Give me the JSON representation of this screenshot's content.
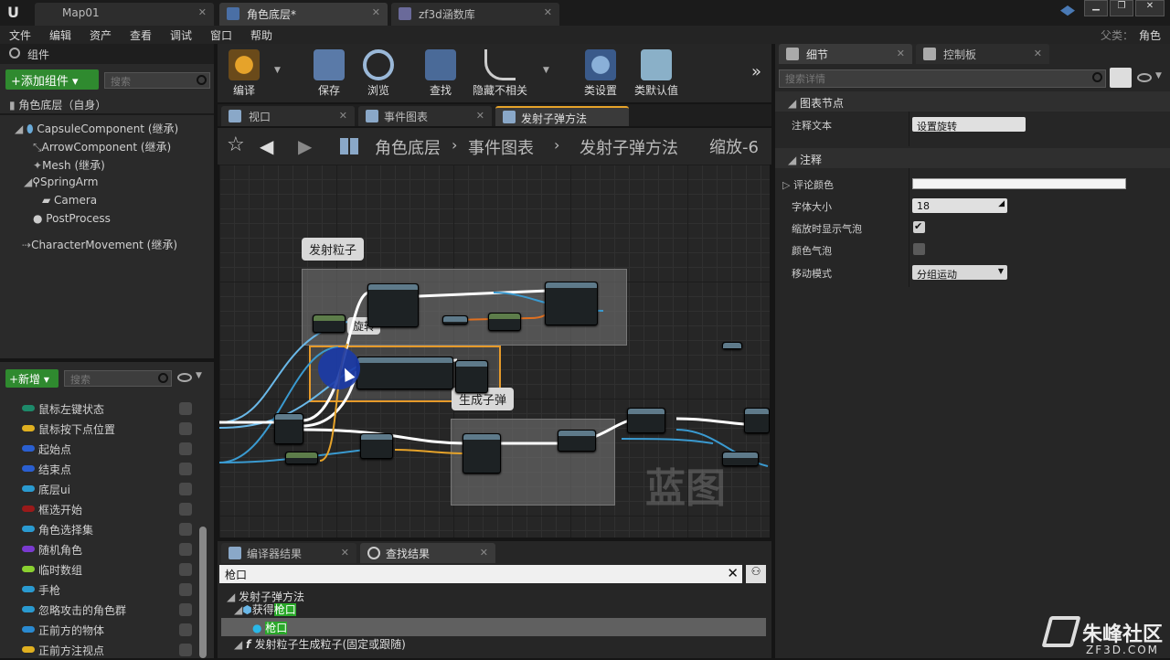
{
  "tabs": [
    {
      "label": "Map01"
    },
    {
      "label": "角色底层*"
    },
    {
      "label": "zf3d涵数库"
    }
  ],
  "menu": [
    "文件",
    "编辑",
    "资产",
    "查看",
    "调试",
    "窗口",
    "帮助"
  ],
  "parent": {
    "label": "父类：",
    "value": "角色"
  },
  "components_panel": {
    "tab": "组件",
    "add_button": "+添加组件 ▾",
    "search_placeholder": "搜索",
    "root": "角色底层（自身）",
    "items": [
      "CapsuleComponent (继承)",
      "ArrowComponent (继承)",
      "Mesh (继承)",
      "SpringArm",
      "Camera",
      "PostProcess",
      "CharacterMovement (继承)"
    ]
  },
  "toolbar": [
    {
      "label": "编译",
      "icon": "compile-icon"
    },
    {
      "label": "保存",
      "icon": "save-icon"
    },
    {
      "label": "浏览",
      "icon": "browse-icon"
    },
    {
      "label": "查找",
      "icon": "find-icon"
    },
    {
      "label": "隐藏不相关",
      "icon": "hide-unrelated-icon"
    },
    {
      "label": "类设置",
      "icon": "class-settings-icon"
    },
    {
      "label": "类默认值",
      "icon": "class-defaults-icon"
    }
  ],
  "editor_tabs": [
    "视口",
    "事件图表",
    "发射子弹方法"
  ],
  "breadcrumb": {
    "root": "角色底层",
    "graph": "事件图表",
    "fn": "发射子弹方法",
    "zoom": "缩放-6"
  },
  "graph": {
    "comment1": "发射粒子",
    "comment2": "生成子弹",
    "partial_label": "旋转",
    "watermark": "蓝图"
  },
  "variables": {
    "new_button": "+新增 ▾",
    "search_placeholder": "搜索",
    "items": [
      {
        "label": "鼠标左键状态",
        "color": "#1d8a6a"
      },
      {
        "label": "鼠标按下点位置",
        "color": "#e0b020"
      },
      {
        "label": "起始点",
        "color": "#2a5fd0"
      },
      {
        "label": "结束点",
        "color": "#2a5fd0"
      },
      {
        "label": "底层ui",
        "color": "#2a9ad0"
      },
      {
        "label": "框选开始",
        "color": "#9a1a1a"
      },
      {
        "label": "角色选择集",
        "color": "#2a9ad0"
      },
      {
        "label": "随机角色",
        "color": "#7a3ad0"
      },
      {
        "label": "临时数组",
        "color": "#8ad030"
      },
      {
        "label": "手枪",
        "color": "#2a9ad0"
      },
      {
        "label": "忽略攻击的角色群",
        "color": "#2a9ad0"
      },
      {
        "label": "正前方的物体",
        "color": "#2a8ad0"
      },
      {
        "label": "正前方注视点",
        "color": "#e0b020"
      }
    ]
  },
  "results": {
    "tabs": [
      "编译器结果",
      "查找结果"
    ],
    "query": "枪口",
    "rows": [
      {
        "prefix": "发射子弹方法",
        "hl": ""
      },
      {
        "prefix": "获得",
        "hl": "枪口"
      },
      {
        "prefix": "",
        "hl": "枪口"
      },
      {
        "prefix": "发射粒子生成粒子(固定或跟随)",
        "hl": ""
      }
    ]
  },
  "details": {
    "tabs": [
      "细节",
      "控制板"
    ],
    "search_placeholder": "搜索详情",
    "section1": "图表节点",
    "comment_text_label": "注释文本",
    "comment_text_value": "设置旋转",
    "section2": "注释",
    "comment_color_label": "评论颜色",
    "font_size_label": "字体大小",
    "font_size_value": "18",
    "zoom_bubble_label": "缩放时显示气泡",
    "zoom_bubble_checked": true,
    "color_bubble_label": "颜色气泡",
    "color_bubble_checked": false,
    "move_mode_label": "移动模式",
    "move_mode_value": "分组运动"
  },
  "brand": {
    "name": "朱峰社区",
    "url": "ZF3D.COM"
  }
}
